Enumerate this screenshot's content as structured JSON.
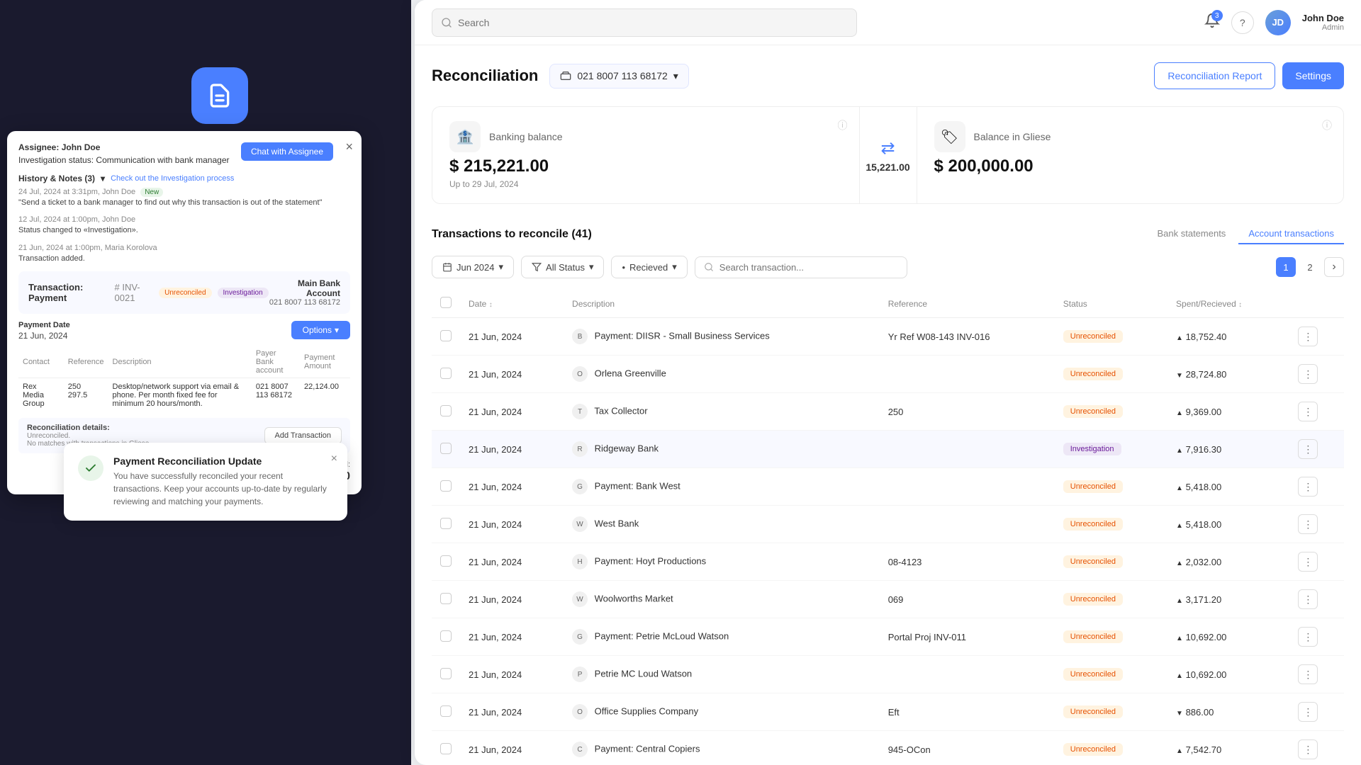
{
  "app": {
    "title": "Reconciliation"
  },
  "header": {
    "search_placeholder": "Search",
    "search_value": "",
    "notifications_count": "3",
    "user_name": "John Doe",
    "user_role": "Admin",
    "user_initials": "JD"
  },
  "modal": {
    "assignee_label": "Assignee:",
    "assignee_name": "John Doe",
    "inv_status_label": "Investigation status:",
    "inv_status_value": "Communication with bank manager",
    "chat_btn": "Chat with Assignee",
    "history_title": "History & Notes (3)",
    "history_link": "Check out the Investigation process",
    "history_items": [
      {
        "date": "24 Jul, 2024 at 3:31pm, John Doe",
        "is_new": true,
        "text": "\"Send a ticket to a bank manager to find out why this transaction is out of the statement\""
      },
      {
        "date": "12 Jul, 2024 at 1:00pm, John Doe",
        "is_new": false,
        "text": "Status changed to «Investigation»."
      },
      {
        "date": "21 Jun, 2024 at 1:00pm, Maria Korolova",
        "is_new": false,
        "text": "Transaction added."
      }
    ],
    "transaction_title": "Transaction: Payment",
    "transaction_id": "# INV-0021",
    "badge_unreconciled": "Unreconciled",
    "badge_investigation": "Investigation",
    "account_label": "Main Bank Account",
    "account_number": "021 8007 113 68172",
    "payment_date_label": "Payment Date",
    "payment_date_value": "21 Jun, 2024",
    "options_btn": "Options",
    "table_headers": [
      "Contact",
      "Reference",
      "Description",
      "Payer Bank account",
      "Payment Amount"
    ],
    "table_row": {
      "contact": "Rex Media Group",
      "reference": "250\n297.5",
      "description": "Desktop/network support via email & phone. Per month fixed fee for minimum 20 hours/month.",
      "payer_account": "021 8007 113 68172",
      "amount": "22,124.00"
    },
    "recon_label": "Reconciliation details:",
    "recon_status": "Unreconciled.",
    "recon_note": "No matches with transactions in Gliese.",
    "add_trans_btn": "Add Transaction",
    "total_label": "Total:",
    "total_amount": "$ 22,124.00",
    "close_icon": "×"
  },
  "toast": {
    "title": "Payment Reconciliation Update",
    "body": "You have successfully reconciled your recent transactions. Keep your accounts up-to-date by regularly reviewing and matching your payments.",
    "close_icon": "×"
  },
  "reconciliation": {
    "title": "Reconciliation",
    "account": "021 8007 113 68172",
    "recon_report_btn": "Reconciliation Report",
    "settings_btn": "Settings",
    "banking_balance_label": "Banking balance",
    "banking_balance_amount": "$ 215,221.00",
    "banking_balance_date": "Up to 29 Jul, 2024",
    "diff_amount": "15,221.00",
    "gliese_balance_label": "Balance in Gliese",
    "gliese_balance_amount": "$ 200,000.00",
    "transactions_count_label": "Transactions to reconcile (41)",
    "tab_bank_statements": "Bank statements",
    "tab_account_transactions": "Account transactions",
    "filter_date": "Jun 2024",
    "filter_status": "All Status",
    "filter_received": "Recieved",
    "search_trans_placeholder": "Search transaction...",
    "page_1": "1",
    "page_2": "2",
    "table_headers": {
      "date": "Date",
      "description": "Description",
      "reference": "Reference",
      "status": "Status",
      "spent_received": "Spent/Recieved"
    },
    "transactions": [
      {
        "date": "21 Jun, 2024",
        "description": "Payment: DIISR - Small Business Services",
        "reference": "Yr Ref W08-143 INV-016",
        "status": "Unreconciled",
        "amount": "18,752.40",
        "direction": "up",
        "icon": "B"
      },
      {
        "date": "21 Jun, 2024",
        "description": "Orlena Greenville",
        "reference": "",
        "status": "Unreconciled",
        "amount": "28,724.80",
        "direction": "down",
        "icon": "O"
      },
      {
        "date": "21 Jun, 2024",
        "description": "Tax Collector",
        "reference": "250",
        "status": "Unreconciled",
        "amount": "9,369.00",
        "direction": "up",
        "icon": "T"
      },
      {
        "date": "21 Jun, 2024",
        "description": "Ridgeway Bank",
        "reference": "",
        "status": "Investigation",
        "amount": "7,916.30",
        "direction": "up",
        "icon": "R"
      },
      {
        "date": "21 Jun, 2024",
        "description": "Payment: Bank West",
        "reference": "",
        "status": "Unreconciled",
        "amount": "5,418.00",
        "direction": "up",
        "icon": "G"
      },
      {
        "date": "21 Jun, 2024",
        "description": "West Bank",
        "reference": "",
        "status": "Unreconciled",
        "amount": "5,418.00",
        "direction": "up",
        "icon": "W"
      },
      {
        "date": "21 Jun, 2024",
        "description": "Payment: Hoyt Productions",
        "reference": "08-4123",
        "status": "Unreconciled",
        "amount": "2,032.00",
        "direction": "up",
        "icon": "H"
      },
      {
        "date": "21 Jun, 2024",
        "description": "Woolworths Market",
        "reference": "069",
        "status": "Unreconciled",
        "amount": "3,171.20",
        "direction": "up",
        "icon": "W"
      },
      {
        "date": "21 Jun, 2024",
        "description": "Payment: Petrie McLoud Watson",
        "reference": "Portal Proj INV-011",
        "status": "Unreconciled",
        "amount": "10,692.00",
        "direction": "up",
        "icon": "G"
      },
      {
        "date": "21 Jun, 2024",
        "description": "Petrie MC Loud Watson",
        "reference": "",
        "status": "Unreconciled",
        "amount": "10,692.00",
        "direction": "up",
        "icon": "P"
      },
      {
        "date": "21 Jun, 2024",
        "description": "Office Supplies Company",
        "reference": "Eft",
        "status": "Unreconciled",
        "amount": "886.00",
        "direction": "down",
        "icon": "O"
      },
      {
        "date": "21 Jun, 2024",
        "description": "Payment: Central Copiers",
        "reference": "945-OCon",
        "status": "Unreconciled",
        "amount": "7,542.70",
        "direction": "up",
        "icon": "C"
      }
    ]
  }
}
